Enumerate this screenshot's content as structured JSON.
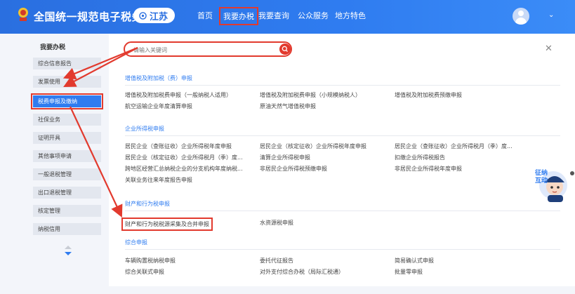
{
  "header": {
    "title": "全国统一规范电子税务局",
    "region": "江苏",
    "nav": [
      {
        "label": "首页"
      },
      {
        "label": "我要办税"
      },
      {
        "label": "我要查询"
      },
      {
        "label": "公众服务"
      },
      {
        "label": "地方特色"
      }
    ]
  },
  "sidebar": {
    "title": "我要办税",
    "items": [
      {
        "label": "综合信息报告"
      },
      {
        "label": "发票使用"
      },
      {
        "label": "税费申报及缴纳"
      },
      {
        "label": "社保业务"
      },
      {
        "label": "证明开具"
      },
      {
        "label": "其他事项申请"
      },
      {
        "label": "一般退税管理"
      },
      {
        "label": "出口退税管理"
      },
      {
        "label": "核定管理"
      },
      {
        "label": "纳税信用"
      }
    ]
  },
  "search": {
    "placeholder": "请输入关键词"
  },
  "sections": [
    {
      "title": "增值税及附加税（费）申报",
      "links": [
        "增值税及附加税费申报（一般纳税人适用）",
        "增值税及附加税费申报（小规模纳税人）",
        "增值税及附加税费预缴申报",
        "航空运输企业年度清算申报",
        "原油天然气增值税申报"
      ]
    },
    {
      "title": "企业所得税申报",
      "links": [
        "居民企业（查账征收）企业所得税年度申报",
        "居民企业（核定征收）企业所得税年度申报",
        "居民企业（查账征收）企业所得税月（季）度...",
        "居民企业（核定征收）企业所得税月（季）度...",
        "清算企业所得税申报",
        "扣缴企业所得税报告",
        "跨地区经营汇总纳税企业的分支机构年度纳税...",
        "非居民企业所得税预缴申报",
        "非居民企业所得税年度申报",
        "关联业务往来年度报告申报"
      ]
    },
    {
      "title": "财产和行为税申报",
      "links": [
        "财产和行为税税源采集及合并申报",
        "水资源税申报"
      ]
    },
    {
      "title": "综合申报",
      "links": [
        "车辆购置税纳税申报",
        "委托代征报告",
        "简易确认式申报",
        "综合关联式申报",
        "对外支付综合办税（局际汇税通）",
        "批量零申报"
      ]
    }
  ],
  "chat": {
    "label": "征纳互动"
  },
  "colors": {
    "primary": "#2f7cf0",
    "highlight": "#e23a2e"
  }
}
